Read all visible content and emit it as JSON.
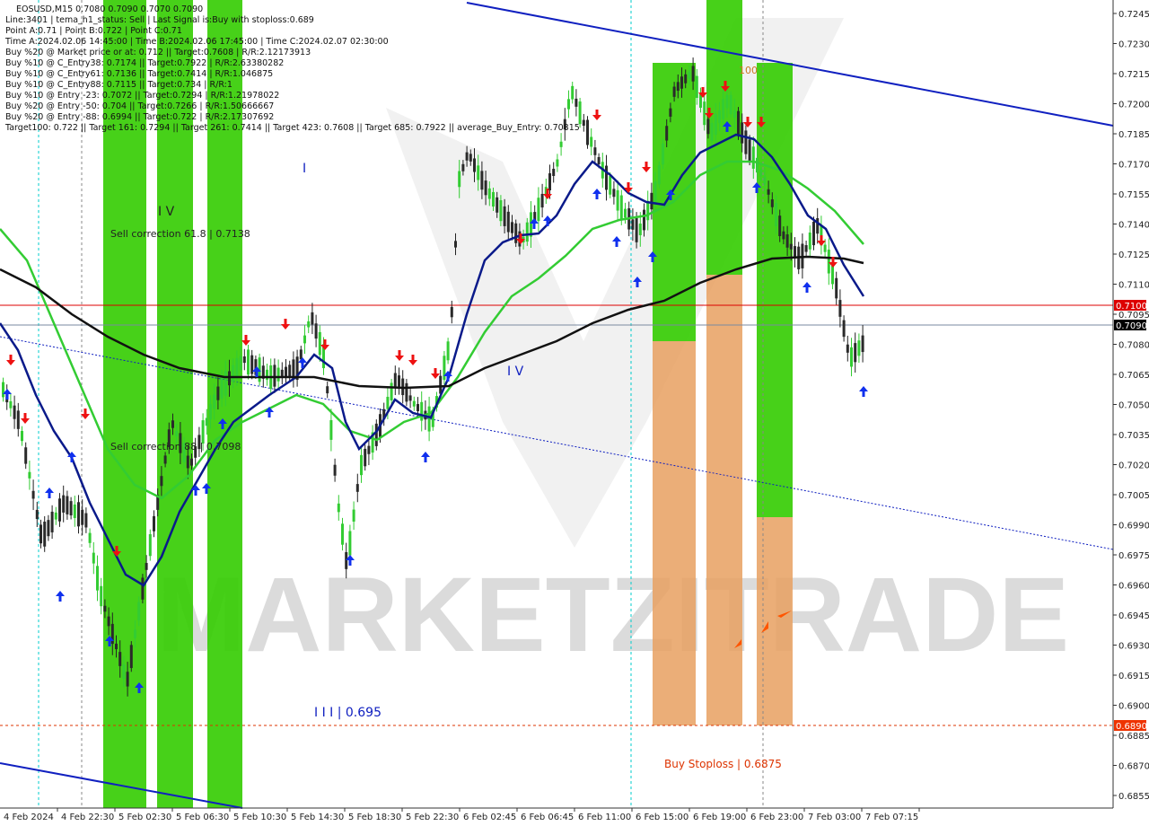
{
  "symbol_line": "EOSUSD,M15  0.7080 0.7090 0.7070 0.7090",
  "info_lines": [
    "Line:3401  | tema_h1_status: Sell  | Last Signal is:Buy with stoploss:0.689",
    "Point A:0.71  | Point B:0.722  | Point C:0.71",
    "Time A:2024.02.06 14:45:00  | Time B:2024.02.06 17:45:00  | Time C:2024.02.07 02:30:00",
    "Buy %20 @ Market price or at: 0.712  || Target:0.7608  | R/R:2.12173913",
    "Buy %10 @ C_Entry38: 0.7174  || Target:0.7922  | R/R:2.63380282",
    "Buy %10 @ C_Entry61: 0.7136  || Target:0.7414  | R/R:1.046875",
    "Buy %10 @ C_Entry88: 0.7115  || Target:0.734  | R/R:1",
    "Buy %10 @ Entry -23: 0.7072  || Target:0.7294  | R/R:1.21978022",
    "Buy %20 @ Entry -50: 0.704  || Target:0.7266  | R/R:1.50666667",
    "Buy %20 @ Entry -88: 0.6994  || Target:0.722  | R/R:2.17307692",
    "Target100: 0.722  || Target 161: 0.7294  || Target 261: 0.7414  || Target 423: 0.7608  || Target 685: 0.7922  || average_Buy_Entry: 0.70815"
  ],
  "annotations": {
    "sell_correction_1": "Sell correction 61.8 | 0.7138",
    "sell_correction_2": "Sell correction 88 | 0.7098",
    "wave_iv_top": "I V",
    "wave_i": "I",
    "wave_iv_mid": "I V",
    "wave_iii": "I I I | 0.695",
    "buy_stoploss": "Buy Stoploss | 0.6875",
    "hundred": "100"
  },
  "price_axis": {
    "ticks": [
      "0.7245",
      "0.7230",
      "0.7215",
      "0.7200",
      "0.7185",
      "0.7170",
      "0.7155",
      "0.7140",
      "0.7125",
      "0.7110",
      "0.7095",
      "0.7080",
      "0.7065",
      "0.7050",
      "0.7035",
      "0.7020",
      "0.7005",
      "0.6990",
      "0.6975",
      "0.6960",
      "0.6945",
      "0.6930",
      "0.6915",
      "0.6900",
      "0.6885",
      "0.6870",
      "0.6855"
    ],
    "red_label": "0.7100",
    "current_label": "0.7090",
    "stop_label": "0.6890"
  },
  "time_axis": [
    "4 Feb 2024",
    "4 Feb 22:30",
    "5 Feb 02:30",
    "5 Feb 06:30",
    "5 Feb 10:30",
    "5 Feb 14:30",
    "5 Feb 18:30",
    "5 Feb 22:30",
    "6 Feb 02:45",
    "6 Feb 06:45",
    "6 Feb 11:00",
    "6 Feb 15:00",
    "6 Feb 19:00",
    "6 Feb 23:00",
    "7 Feb 03:00",
    "7 Feb 07:15"
  ],
  "watermark": "MARKETZITRADE",
  "colors": {
    "green_zone": "#33cc00",
    "orange_zone": "#e8a060",
    "blue_line": "#1020c0",
    "red_line": "#dd0000",
    "ma_black": "#000000",
    "ma_navy": "#0a1a8a",
    "ma_green": "#33cc33"
  }
}
